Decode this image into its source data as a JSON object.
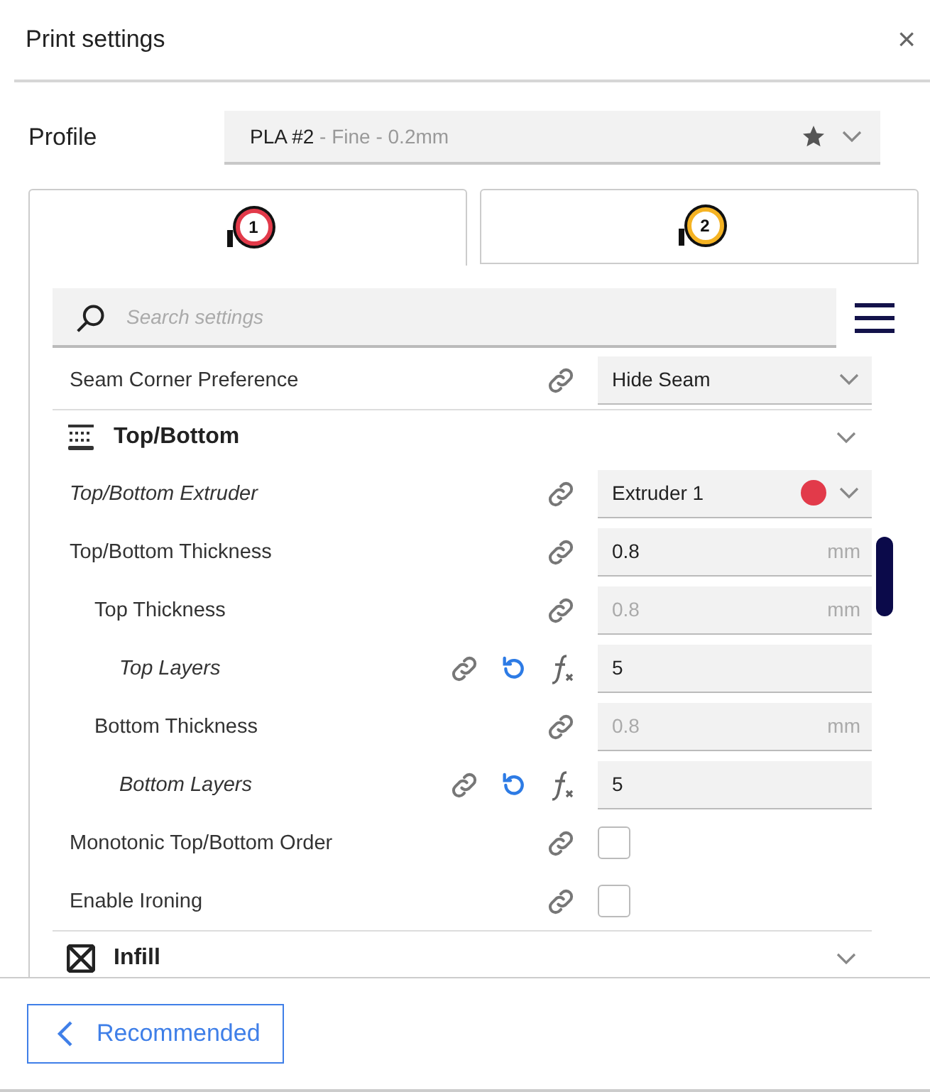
{
  "window": {
    "title": "Print settings",
    "close": "×"
  },
  "profile": {
    "label": "Profile",
    "name": "PLA #2",
    "detail": " - Fine - 0.2mm"
  },
  "extruder_tabs": [
    {
      "number": "1",
      "color": "#e23a4a",
      "selected": true
    },
    {
      "number": "2",
      "color": "#f5b323",
      "selected": false
    }
  ],
  "search": {
    "placeholder": "Search settings"
  },
  "settings_list": [
    {
      "kind": "dropdown",
      "label": "Seam Corner Preference",
      "emphasized": false,
      "value": "Hide Seam"
    },
    {
      "kind": "category",
      "title": "Top/Bottom",
      "settings": [
        {
          "label": "Top/Bottom Extruder",
          "emphasized": true,
          "kind": "dropdown",
          "value": "Extruder 1",
          "color": "#e23a4a"
        },
        {
          "label": "Top/Bottom Thickness",
          "emphasized": false,
          "kind": "number",
          "value": "0.8",
          "unit": "mm",
          "disabled": false,
          "children": [
            {
              "label": "Top Thickness",
              "emphasized": false,
              "kind": "number",
              "value": "0.8",
              "unit": "mm",
              "disabled": true,
              "children": [
                {
                  "label": "Top Layers",
                  "emphasized": true,
                  "kind": "number",
                  "value": "5",
                  "disabled": false,
                  "resettable": true,
                  "formula": true
                }
              ]
            },
            {
              "label": "Bottom Thickness",
              "emphasized": false,
              "kind": "number",
              "value": "0.8",
              "unit": "mm",
              "disabled": true,
              "children": [
                {
                  "label": "Bottom Layers",
                  "emphasized": true,
                  "kind": "number",
                  "value": "5",
                  "disabled": false,
                  "resettable": true,
                  "formula": true
                }
              ]
            }
          ]
        },
        {
          "label": "Monotonic Top/Bottom Order",
          "emphasized": false,
          "kind": "checkbox",
          "checked": false
        },
        {
          "label": "Enable Ironing",
          "emphasized": false,
          "kind": "checkbox",
          "checked": false
        }
      ]
    },
    {
      "kind": "category",
      "title": "Infill"
    }
  ],
  "footer": {
    "button": "Recommended"
  }
}
